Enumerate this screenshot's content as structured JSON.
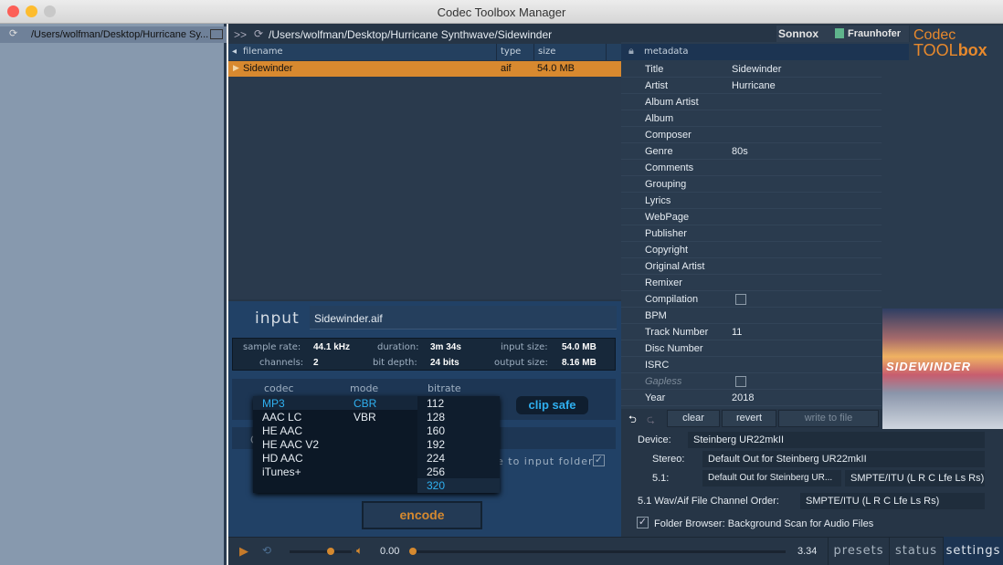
{
  "window": {
    "title": "Codec Toolbox Manager"
  },
  "sidebar": {
    "path": "/Users/wolfman/Desktop/Hurricane Sy..."
  },
  "browser": {
    "nav": ">>",
    "path": "/Users/wolfman/Desktop/Hurricane Synthwave/Sidewinder",
    "columns": [
      "filename",
      "type",
      "size"
    ],
    "rows": [
      {
        "filename": "Sidewinder",
        "type": "aif",
        "size": "54.0 MB",
        "selected": true
      }
    ]
  },
  "branding": {
    "sonnox": "Sonnox",
    "fraunhofer": "Fraunhofer",
    "logo_line1": "Codec",
    "logo_tool": "TOOL",
    "logo_box": "box",
    "accent": "#e8892c"
  },
  "input": {
    "label": "input",
    "filename": "Sidewinder.aif",
    "stats": {
      "sample_rate_label": "sample rate:",
      "sample_rate": "44.1 kHz",
      "channels_label": "channels:",
      "channels": "2",
      "duration_label": "duration:",
      "duration": "3m 34s",
      "bit_depth_label": "bit depth:",
      "bit_depth": "24 bits",
      "input_size_label": "input size:",
      "input_size": "54.0 MB",
      "output_size_label": "output size:",
      "output_size": "8.16 MB"
    }
  },
  "encoder": {
    "codec_header": "codec",
    "mode_header": "mode",
    "bitrate_header": "bitrate",
    "codecs": [
      "MP3",
      "AAC LC",
      "HE AAC",
      "HE AAC V2",
      "HD AAC",
      "iTunes+"
    ],
    "selected_codec": "MP3",
    "modes": [
      "CBR",
      "VBR"
    ],
    "selected_mode": "CBR",
    "bitrates": [
      "112",
      "128",
      "160",
      "192",
      "224",
      "256",
      "320"
    ],
    "selected_bitrate": "320",
    "clip_safe": "clip safe",
    "hidden_label_fragment": "C",
    "save_fragment": "e to input folder",
    "save_checked": true,
    "encode": "encode"
  },
  "metadata": {
    "header": "metadata",
    "fields": [
      {
        "k": "Title",
        "v": "Sidewinder"
      },
      {
        "k": "Artist",
        "v": "Hurricane"
      },
      {
        "k": "Album Artist",
        "v": ""
      },
      {
        "k": "Album",
        "v": ""
      },
      {
        "k": "Composer",
        "v": ""
      },
      {
        "k": "Genre",
        "v": "80s"
      },
      {
        "k": "Comments",
        "v": ""
      },
      {
        "k": "Grouping",
        "v": ""
      },
      {
        "k": "Lyrics",
        "v": ""
      },
      {
        "k": "WebPage",
        "v": ""
      },
      {
        "k": "Publisher",
        "v": ""
      },
      {
        "k": "Copyright",
        "v": ""
      },
      {
        "k": "Original Artist",
        "v": ""
      },
      {
        "k": "Remixer",
        "v": ""
      },
      {
        "k": "Compilation",
        "v": ""
      },
      {
        "k": "BPM",
        "v": ""
      },
      {
        "k": "Track Number",
        "v": "11"
      },
      {
        "k": "Disc Number",
        "v": ""
      },
      {
        "k": "ISRC",
        "v": ""
      },
      {
        "k": "Gapless",
        "v": ""
      },
      {
        "k": "Year",
        "v": "2018"
      }
    ],
    "artwork_text": "SIDEWINDER",
    "clear": "clear",
    "revert": "revert",
    "write": "write to file"
  },
  "settings": {
    "device_label": "Device:",
    "device": "Steinberg UR22mkII",
    "stereo_label": "Stereo:",
    "stereo": "Default Out for Steinberg UR22mkII",
    "surround_label": "5.1:",
    "surround_out": "Default Out for Steinberg UR...",
    "surround_order": "SMPTE/ITU (L R C Lfe Ls Rs)",
    "file_order_label": "5.1 Wav/Aif File Channel Order:",
    "file_order": "SMPTE/ITU (L R C Lfe Ls Rs)",
    "bg_scan_label": "Folder Browser: Background Scan for Audio Files",
    "bg_scan_checked": true
  },
  "player": {
    "position": "0.00",
    "duration": "3.34",
    "volume": 0.75,
    "progress": 0
  },
  "tabs": [
    "presets",
    "status",
    "settings"
  ],
  "active_tab": "settings"
}
